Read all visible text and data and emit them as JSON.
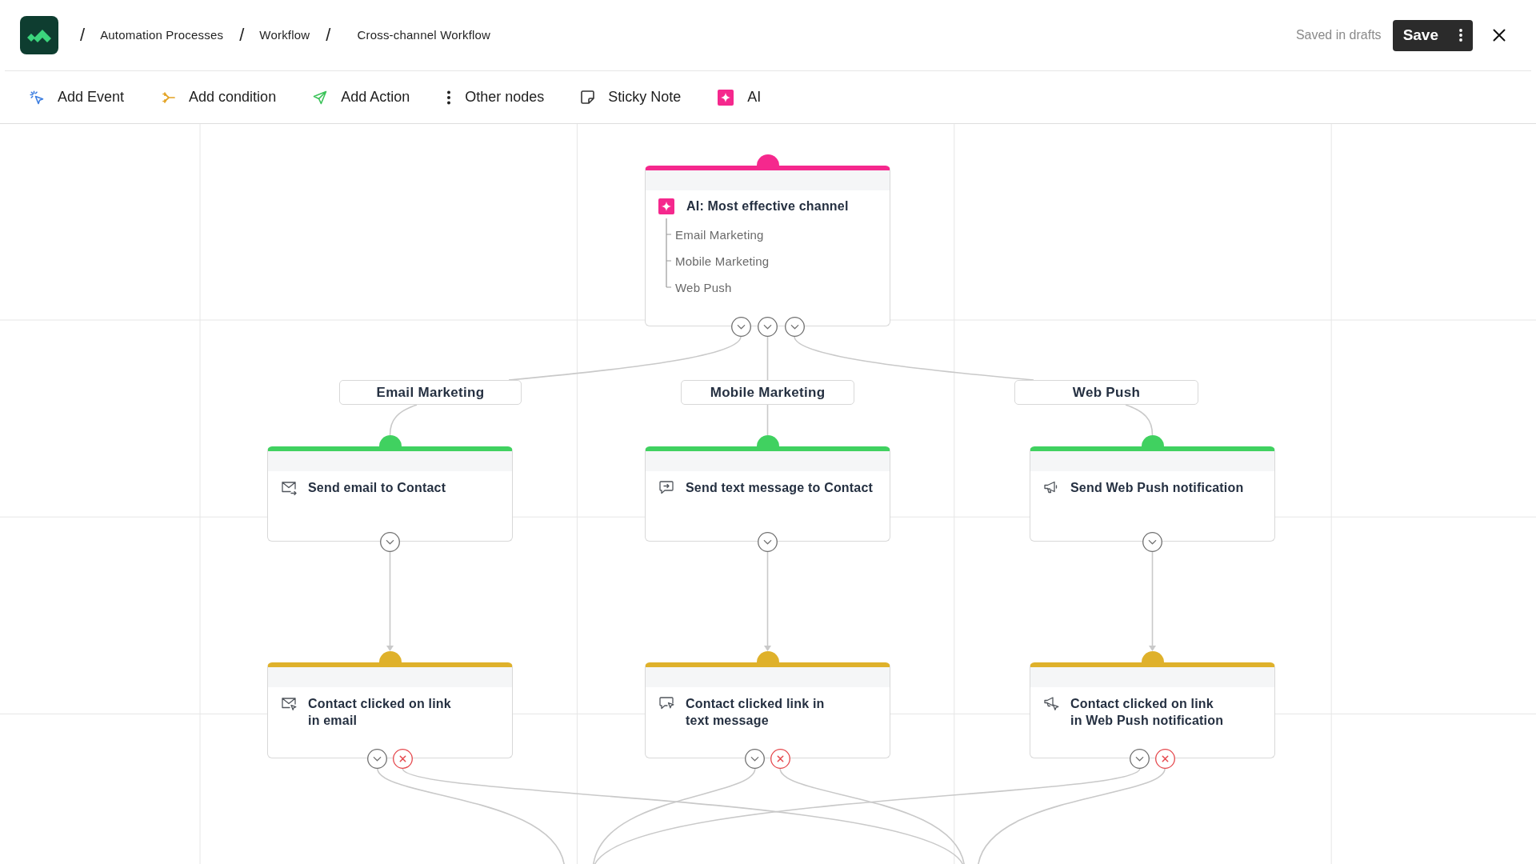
{
  "header": {
    "breadcrumbs": [
      {
        "separator": "/",
        "label": "Automation Processes"
      },
      {
        "separator": "/",
        "label": "Workflow"
      },
      {
        "separator": "/",
        "label": "Cross-channel Workflow"
      }
    ],
    "status": "Saved in drafts",
    "save_label": "Save"
  },
  "toolbar": [
    {
      "kind": "event",
      "label": "Add Event"
    },
    {
      "kind": "condition",
      "label": "Add condition"
    },
    {
      "kind": "action",
      "label": "Add Action"
    },
    {
      "kind": "other",
      "label": "Other nodes"
    },
    {
      "kind": "note",
      "label": "Sticky Note"
    },
    {
      "kind": "ai",
      "label": "AI"
    }
  ],
  "canvas": {
    "ai_node": {
      "title": "AI: Most effective channel",
      "options": [
        "Email Marketing",
        "Mobile Marketing",
        "Web Push"
      ]
    },
    "branches": [
      {
        "label": "Email Marketing",
        "nodes": [
          {
            "kind": "action",
            "title": "Send email to Contact"
          },
          {
            "kind": "condition",
            "title": "Contact clicked on link\nin email"
          }
        ]
      },
      {
        "label": "Mobile Marketing",
        "nodes": [
          {
            "kind": "action",
            "title": "Send text message to Contact"
          },
          {
            "kind": "condition",
            "title": "Contact clicked link in\ntext message"
          }
        ]
      },
      {
        "label": "Web Push",
        "nodes": [
          {
            "kind": "action",
            "title": "Send Web Push notification"
          },
          {
            "kind": "condition",
            "title": "Contact clicked on link\nin Web Push notification"
          }
        ]
      }
    ]
  }
}
